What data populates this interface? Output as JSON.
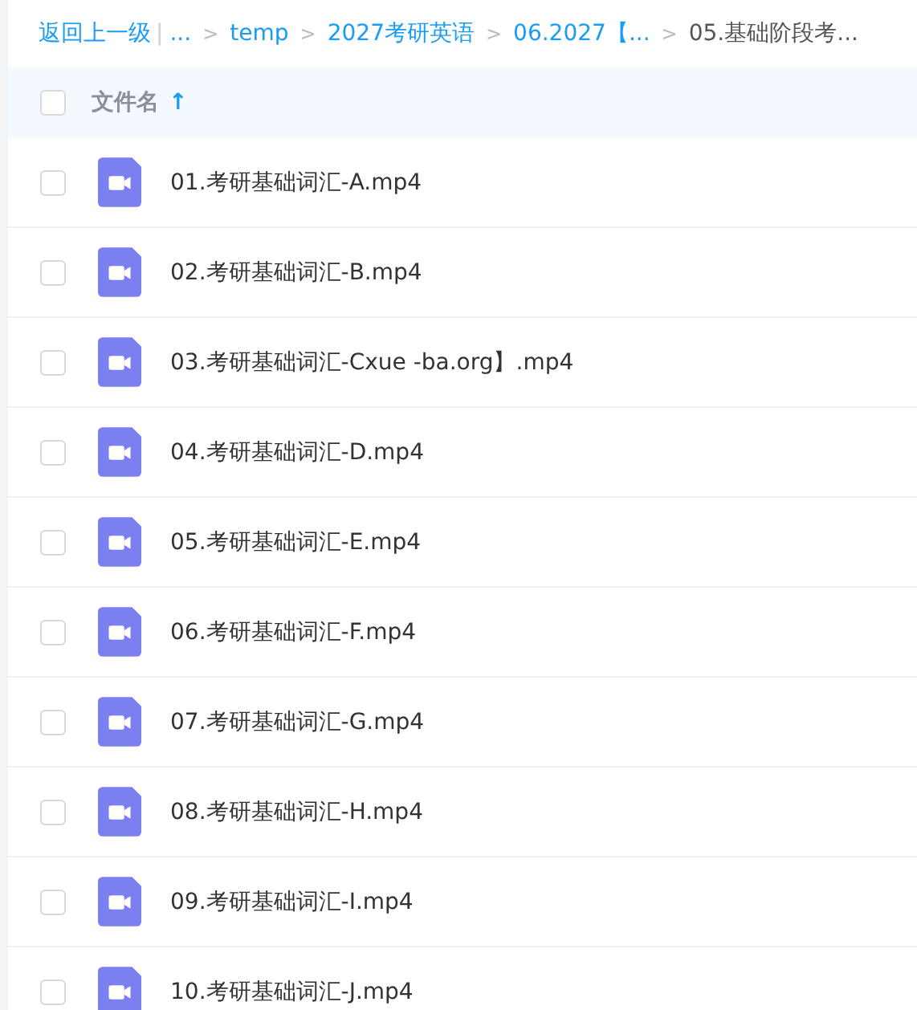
{
  "breadcrumb": {
    "back": "返回上一级",
    "divider": "|",
    "separator": ">",
    "items": [
      {
        "label": "...",
        "current": false
      },
      {
        "label": "temp",
        "current": false
      },
      {
        "label": "2027考研英语",
        "current": false
      },
      {
        "label": "06.2027【...",
        "current": false
      },
      {
        "label": "05.基础阶段考...",
        "current": true
      }
    ]
  },
  "header": {
    "checked": false,
    "column": "文件名",
    "sort_arrow": "↑"
  },
  "files": [
    {
      "name": "01.考研基础词汇-A.mp4",
      "checked": false
    },
    {
      "name": "02.考研基础词汇-B.mp4",
      "checked": false
    },
    {
      "name": "03.考研基础词汇-Cxue -ba.org】.mp4",
      "checked": false
    },
    {
      "name": "04.考研基础词汇-D.mp4",
      "checked": false
    },
    {
      "name": "05.考研基础词汇-E.mp4",
      "checked": false
    },
    {
      "name": "06.考研基础词汇-F.mp4",
      "checked": false
    },
    {
      "name": "07.考研基础词汇-G.mp4",
      "checked": false
    },
    {
      "name": "08.考研基础词汇-H.mp4",
      "checked": false
    },
    {
      "name": "09.考研基础词汇-I.mp4",
      "checked": false
    },
    {
      "name": "10.考研基础词汇-J.mp4",
      "checked": false
    }
  ]
}
